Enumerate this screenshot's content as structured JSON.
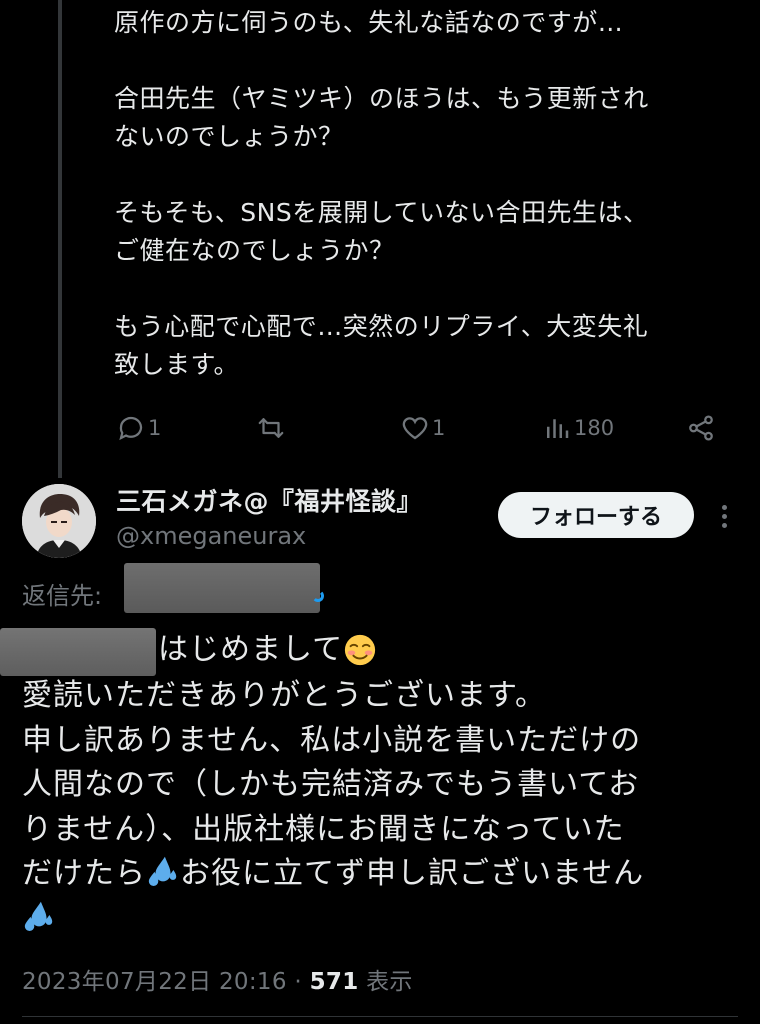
{
  "parent_reply": {
    "text": "原作の方に伺うのも、失礼な話なのですが…\n\n合田先生（ヤミツキ）のほうは、もう更新され\nないのでしょうか？\n\nそもそも、SNSを展開していない合田先生は、\nご健在なのでしょうか？\n\nもう心配で心配で…突然のリプライ、大変失礼\n致します。",
    "reply_count": "1",
    "retweet_count": "",
    "like_count": "1",
    "view_count": "180"
  },
  "tweet": {
    "author_name": "三石メガネ@『福井怪談』",
    "handle": "@xmeganeurax",
    "follow_label": "フォローする",
    "replying_to_label": "返信先:",
    "first_line": "はじめまして",
    "lines": [
      "愛読いただきありがとうございます。",
      "申し訳ありません、私は小説を書いただけの",
      "人間なので（しかも完結済みでもう書いてお",
      "りません）、出版社様にお聞きになっていた",
      "だけたら"
    ],
    "line5_tail": "お役に立てず申し訳ございません",
    "timestamp": "2023年07月22日 20:16 · ",
    "views": "571",
    "views_label": " 表示"
  },
  "icons": {
    "reply": "speech-bubble-icon",
    "retweet": "retweet-icon",
    "like": "heart-icon",
    "views": "bar-chart-icon",
    "share": "share-icon",
    "emoji_smile": "smiling-face-emoji",
    "emoji_sweat": "sweat-droplets-emoji"
  },
  "colors": {
    "background": "#000000",
    "text": "#e7e9ea",
    "muted": "#71767b",
    "accent": "#1d9bf0",
    "follow_bg": "#eff3f4"
  }
}
